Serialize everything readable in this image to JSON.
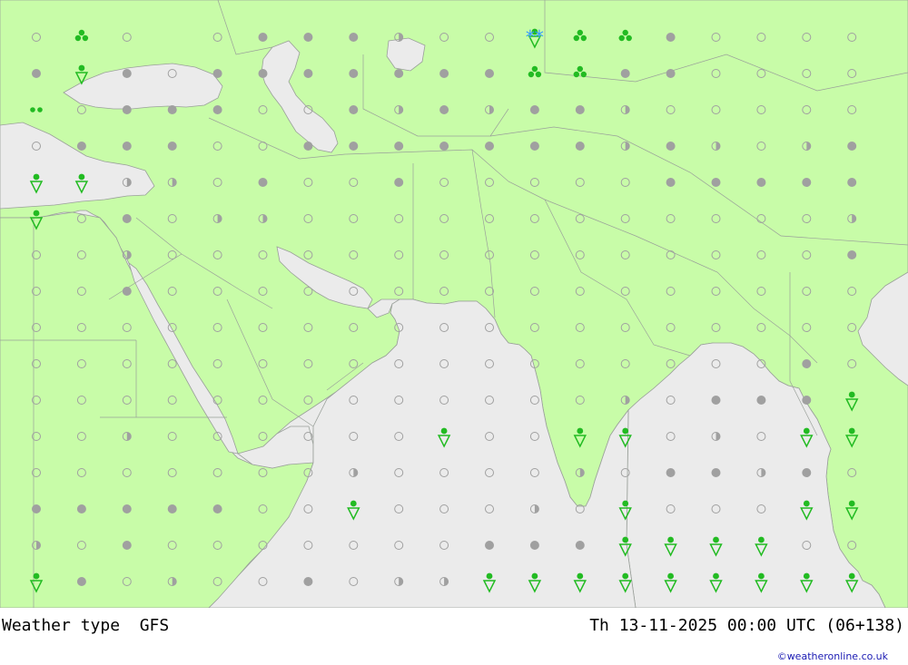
{
  "title_left": "Weather type  GFS",
  "title_right": "Th 13-11-2025 00:00 UTC (06+138)",
  "credit": "©weatheronline.co.uk",
  "colors": {
    "land": "#c8fca8",
    "sea": "#ebebeb",
    "border": "#9aa09a",
    "symbol_gray": "#a0a0a0",
    "precip_green": "#22bb22",
    "snow_blue": "#3399ff"
  },
  "symbol_rows": [
    "c r c . c f f f h c c s r r f c c c c",
    "f a f c f f f f f f f r r f f c c c c",
    "i c f f f c c f h f h f f h c c c c c",
    "c f f f c c f f f f f f f h f h c h f",
    "s s h h c f c c f c c c c c f f f f f",
    "s c f c h h c c c c c c c c c c c c h",
    "c c h c c c c c c c c c c c c c c c f",
    "c c f c c c c c c c c c c c c c c c c",
    "c c c c c c c c c c c c c c c c c c c",
    "c c c c c c c c c c c c c c c c c f c",
    "c c c c c c c c c c c c c h c f f f s",
    "c c h c c c c c c s c c s s c h c s s",
    "c c c c c c c h c c c c h c f f h f c",
    "f f f f f c c s c c c h c s c c c s s",
    "h c f c c c c c c c f f f s s s s c c",
    "s f c h c c f c h h s s s s s s s s s"
  ],
  "legend_symbols": {
    "c": "dry-clear-icon",
    "f": "dry-overcast-icon",
    "h": "dry-partly-cloudy-icon",
    "s": "shower-icon",
    "r": "heavy-rain-icon",
    "i": "rain-icon",
    "a": "rain-shower-icon",
    "z": "snow-icon",
    ".": "none"
  },
  "special_markers": [
    {
      "type": "snow",
      "row": 0,
      "col": 11,
      "label": "**"
    }
  ]
}
